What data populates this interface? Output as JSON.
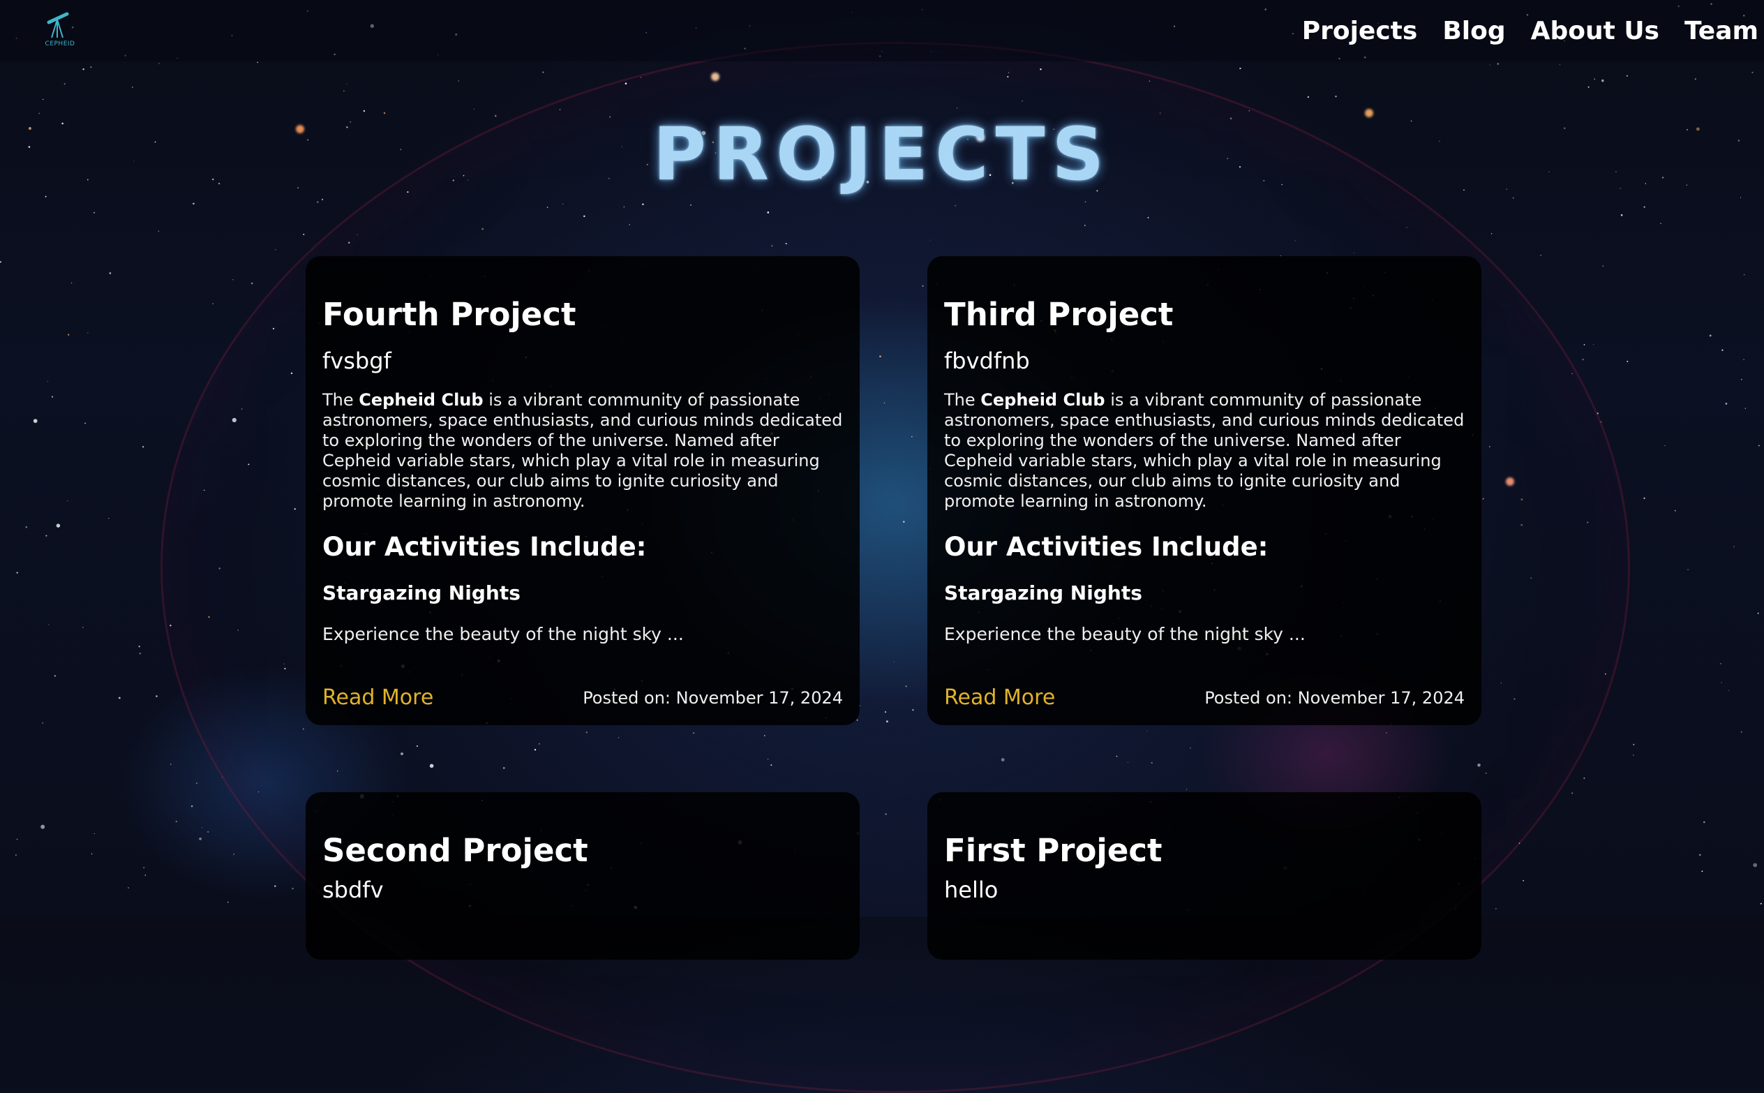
{
  "nav": {
    "logo_text": "CEPHEID",
    "links": [
      "Projects",
      "Blog",
      "About Us",
      "Team"
    ]
  },
  "page": {
    "title": "PROJECTS"
  },
  "projects": [
    {
      "title": "Fourth Project",
      "subtitle": "fvsbgf",
      "desc_prefix": "The ",
      "desc_bold": "Cepheid Club",
      "desc_rest": " is a vibrant community of passionate astronomers, space enthusiasts, and curious minds dedicated to exploring the wonders of the universe. Named after Cepheid variable stars, which play a vital role in measuring cosmic distances, our club aims to ignite curiosity and promote learning in astronomy.",
      "activities_heading": "Our Activities Include:",
      "activity_title": "Stargazing Nights",
      "excerpt": "Experience the beauty of the night sky ...",
      "read_more": "Read More",
      "posted": "Posted on: November 17, 2024"
    },
    {
      "title": "Third Project",
      "subtitle": "fbvdfnb",
      "desc_prefix": "The ",
      "desc_bold": "Cepheid Club",
      "desc_rest": " is a vibrant community of passionate astronomers, space enthusiasts, and curious minds dedicated to exploring the wonders of the universe. Named after Cepheid variable stars, which play a vital role in measuring cosmic distances, our club aims to ignite curiosity and promote learning in astronomy.",
      "activities_heading": "Our Activities Include:",
      "activity_title": "Stargazing Nights",
      "excerpt": "Experience the beauty of the night sky ...",
      "read_more": "Read More",
      "posted": "Posted on: November 17, 2024"
    },
    {
      "title": "Second Project",
      "subtitle": "sbdfv"
    },
    {
      "title": "First Project",
      "subtitle": "hello"
    }
  ],
  "colors": {
    "accent_link": "#e0b32a",
    "title_glow": "#a9d6f5",
    "logo": "#3fb6c9"
  },
  "icons": {
    "logo": "telescope-icon"
  }
}
